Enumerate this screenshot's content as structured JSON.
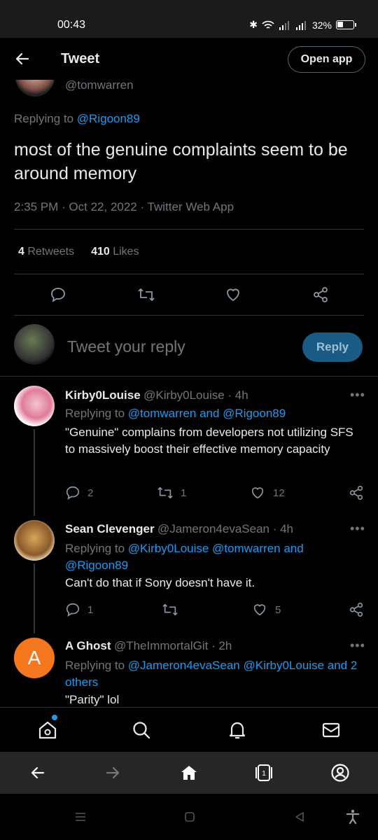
{
  "status": {
    "time": "00:43",
    "battery": "32%"
  },
  "header": {
    "title": "Tweet",
    "open_app": "Open app"
  },
  "main_tweet": {
    "handle": "@tomwarren",
    "replying_prefix": "Replying to",
    "replying_to": "@Rigoon89",
    "text": "most of the genuine complaints seem to be around memory",
    "meta": "2:35 PM · Oct 22, 2022 · Twitter Web App",
    "retweets_count": "4",
    "retweets_label": "Retweets",
    "likes_count": "410",
    "likes_label": "Likes"
  },
  "compose": {
    "placeholder": "Tweet your reply",
    "button": "Reply"
  },
  "replies": [
    {
      "name": "Kirby0Louise",
      "handle_time": "@Kirby0Louise · 4h",
      "replying_prefix": "Replying to",
      "replying_to": "@tomwarren and @Rigoon89",
      "text": "\"Genuine\" complains from developers not utilizing SFS to massively boost their effective memory capacity",
      "replies": "2",
      "retweets": "1",
      "likes": "12"
    },
    {
      "name": "Sean Clevenger",
      "handle_time": "@Jameron4evaSean · 4h",
      "replying_prefix": "Replying to",
      "replying_to": "@Kirby0Louise @tomwarren and @Rigoon89",
      "text": "Can't do that if Sony doesn't have it.",
      "replies": "1",
      "retweets": "",
      "likes": "5"
    },
    {
      "name": "A Ghost",
      "handle_time": "@TheImmortalGit · 2h",
      "replying_prefix": "Replying to",
      "replying_to": "@Jameron4evaSean @Kirby0Louise and 2 others",
      "text": "\"Parity\" lol",
      "avatar_letter": "A",
      "avatar_color": "#f4761d"
    }
  ],
  "colors": {
    "accent": "#1d9bf0",
    "background": "#000000"
  }
}
